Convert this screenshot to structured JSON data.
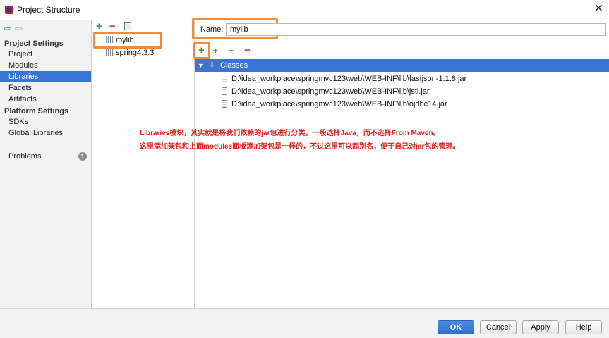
{
  "window": {
    "title": "Project Structure"
  },
  "nav": {
    "back_icon": "arrow-left-icon",
    "forward_icon": "arrow-right-icon",
    "project_settings_header": "Project Settings",
    "project_settings": [
      "Project",
      "Modules",
      "Libraries",
      "Facets",
      "Artifacts"
    ],
    "selected": "Libraries",
    "platform_settings_header": "Platform Settings",
    "platform_settings": [
      "SDKs",
      "Global Libraries"
    ],
    "problems_label": "Problems",
    "problems_count": "1"
  },
  "libraries": {
    "toolbar": {
      "add": "+",
      "remove": "−"
    },
    "items": [
      "mylib",
      "spring4.3.3"
    ],
    "selected": "mylib"
  },
  "details": {
    "name_label": "Name:",
    "name_value": "mylib",
    "toolbar": {
      "add": "+",
      "remove": "−"
    },
    "classes_label": "Classes",
    "jars": [
      "D:\\idea_workplace\\springmvc123\\web\\WEB-INF\\lib\\fastjson-1.1.8.jar",
      "D:\\idea_workplace\\springmvc123\\web\\WEB-INF\\lib\\jstl.jar",
      "D:\\idea_workplace\\springmvc123\\web\\WEB-INF\\lib\\ojdbc14.jar"
    ]
  },
  "annotation": {
    "line1": "Libraries模块，其实就是将我们依赖的jar包进行分类，一般选择Java，而不选择From Maven。",
    "line2": "这里添加架包和上面modules面板添加架包是一样的，不过这里可以起别名，便于自己对jar包的管理。"
  },
  "buttons": {
    "ok": "OK",
    "cancel": "Cancel",
    "apply": "Apply",
    "help": "Help"
  },
  "colors": {
    "selection": "#3875d7",
    "highlight": "#f08c3a",
    "annotation": "#e02020",
    "add": "#3f9a36",
    "remove": "#d93a3a"
  }
}
